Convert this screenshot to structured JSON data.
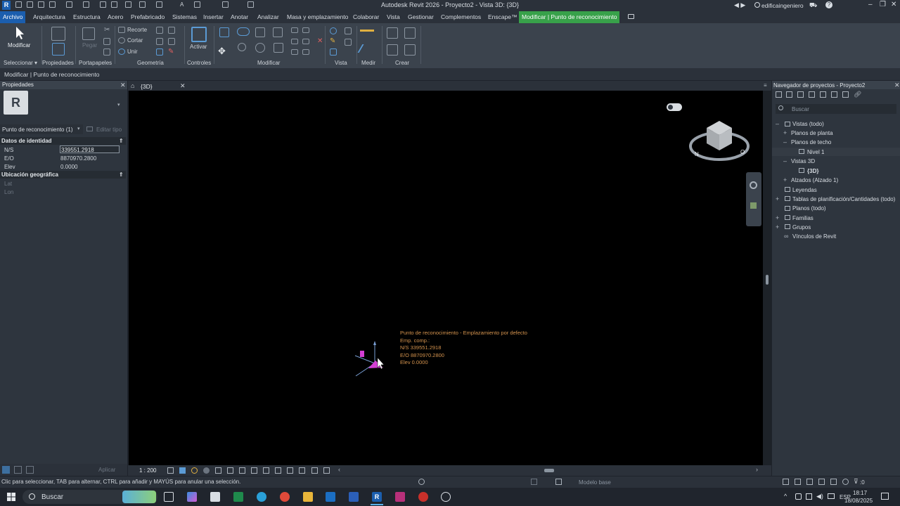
{
  "titlebar": {
    "title": "Autodesk Revit 2026 - Proyecto2 - Vista 3D: {3D}",
    "user": "edificaingeniero"
  },
  "tabs": [
    "Archivo",
    "Arquitectura",
    "Estructura",
    "Acero",
    "Prefabricado",
    "Sistemas",
    "Insertar",
    "Anotar",
    "Analizar",
    "Masa y emplazamiento",
    "Colaborar",
    "Vista",
    "Gestionar",
    "Complementos",
    "Enscape™",
    "Modificar | Punto de reconocimiento"
  ],
  "ribbon": {
    "modificar_btn": "Modificar",
    "pegar": "Pegar",
    "recorte": "Recorte",
    "cortar": "Cortar",
    "unir": "Unir",
    "activar": "Activar",
    "groups": [
      "Seleccionar",
      "Propiedades",
      "Portapapeles",
      "Geometría",
      "Controles",
      "Modificar",
      "Vista",
      "Medir",
      "Crear"
    ]
  },
  "optionbar": {
    "text": "Modificar | Punto de reconocimiento"
  },
  "properties": {
    "title": "Propiedades",
    "type_selector": "Punto de reconocimiento (1)",
    "edit_type": "Editar tipo",
    "section_identity": "Datos de identidad",
    "ns_label": "N/S",
    "ns_value": "339551.2918",
    "eo_label": "E/O",
    "eo_value": "8870970.2800",
    "elev_label": "Elev",
    "elev_value": "0.0000",
    "section_geo": "Ubicación geográfica",
    "lat_label": "Lat",
    "lon_label": "Lon",
    "apply": "Aplicar"
  },
  "view": {
    "tab_label": "{3D}",
    "scale": "1 : 200",
    "annotation": {
      "title": "Punto de reconocimiento - Emplazamiento por defecto",
      "line1": "Emp. comp.:",
      "line2": "N/S   339551.2918",
      "line3": "E/O   8870970.2800",
      "line4": "Elev   0.0000"
    }
  },
  "browser": {
    "title": "Navegador de proyectos - Proyecto2",
    "search_placeholder": "Buscar",
    "items": [
      {
        "label": "Vistas (todo)"
      },
      {
        "label": "Planos de planta"
      },
      {
        "label": "Planos de techo"
      },
      {
        "label": "Nivel 1"
      },
      {
        "label": "Vistas 3D"
      },
      {
        "label": "{3D}"
      },
      {
        "label": "Alzados (Alzado 1)"
      },
      {
        "label": "Leyendas"
      },
      {
        "label": "Tablas de planificación/Cantidades (todo)"
      },
      {
        "label": "Planos (todo)"
      },
      {
        "label": "Familias"
      },
      {
        "label": "Grupos"
      },
      {
        "label": "Vínculos de Revit"
      }
    ]
  },
  "statusbar": {
    "text": "Clic para seleccionar, TAB para alternar, CTRL para añadir y MAYÚS para anular una selección.",
    "model": "Modelo base",
    "filter_count": ":0"
  },
  "taskbar": {
    "search": "Buscar",
    "lang": "ESP",
    "time": "18:17",
    "date": "18/08/2025"
  },
  "colors": {
    "accent_blue": "#1b5eae",
    "context_green": "#38a14a",
    "annotation": "#d4934e",
    "magenta": "#d43fd4"
  }
}
